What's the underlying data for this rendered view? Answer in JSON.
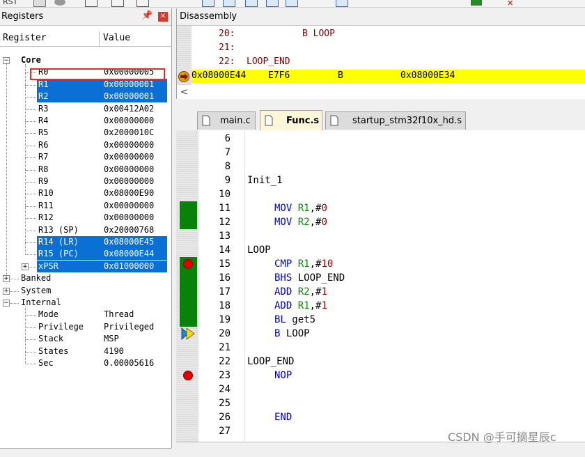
{
  "toolbar": {
    "rst_label": "RST"
  },
  "registers_panel": {
    "title": "Registers",
    "pin_icon": "pin-icon",
    "close_icon": "close-icon",
    "columns": {
      "register": "Register",
      "value": "Value"
    },
    "core_label": "Core",
    "core_registers": [
      {
        "name": "R0",
        "value": "0x00000005",
        "selected": false,
        "highlighted": true
      },
      {
        "name": "R1",
        "value": "0x00000001",
        "selected": true
      },
      {
        "name": "R2",
        "value": "0x00000001",
        "selected": true
      },
      {
        "name": "R3",
        "value": "0x00412A02",
        "selected": false
      },
      {
        "name": "R4",
        "value": "0x00000000",
        "selected": false
      },
      {
        "name": "R5",
        "value": "0x2000010C",
        "selected": false
      },
      {
        "name": "R6",
        "value": "0x00000000",
        "selected": false
      },
      {
        "name": "R7",
        "value": "0x00000000",
        "selected": false
      },
      {
        "name": "R8",
        "value": "0x00000000",
        "selected": false
      },
      {
        "name": "R9",
        "value": "0x00000000",
        "selected": false
      },
      {
        "name": "R10",
        "value": "0x08000E90",
        "selected": false
      },
      {
        "name": "R11",
        "value": "0x00000000",
        "selected": false
      },
      {
        "name": "R12",
        "value": "0x00000000",
        "selected": false
      },
      {
        "name": "R13 (SP)",
        "value": "0x20000768",
        "selected": false
      },
      {
        "name": "R14 (LR)",
        "value": "0x08000E45",
        "selected": true
      },
      {
        "name": "R15 (PC)",
        "value": "0x08000E44",
        "selected": true
      },
      {
        "name": "xPSR",
        "value": "0x01000000",
        "selected": true
      }
    ],
    "groups": [
      "Banked",
      "System",
      "Internal"
    ],
    "internal": [
      {
        "name": "Mode",
        "value": "Thread"
      },
      {
        "name": "Privilege",
        "value": "Privileged"
      },
      {
        "name": "Stack",
        "value": "MSP"
      },
      {
        "name": "States",
        "value": "4190"
      },
      {
        "name": "Sec",
        "value": "0.00005616"
      }
    ]
  },
  "disassembly": {
    "title": "Disassembly",
    "lines": [
      {
        "num": "20:",
        "text": "B LOOP"
      },
      {
        "num": "21:",
        "text": ""
      },
      {
        "num": "22:",
        "text": "LOOP_END"
      }
    ],
    "current": {
      "address": "0x08000E44",
      "opcode": "E7F6",
      "mnemonic": "B",
      "target": "0x08000E34"
    }
  },
  "tabs": [
    {
      "label": "main.c",
      "active": false
    },
    {
      "label": "Func.s",
      "active": true
    },
    {
      "label": "startup_stm32f10x_hd.s",
      "active": false
    }
  ],
  "editor": {
    "lines": [
      {
        "num": "6",
        "code": ""
      },
      {
        "num": "7",
        "code": ""
      },
      {
        "num": "8",
        "code": ""
      },
      {
        "num": "9",
        "code": "Init_1"
      },
      {
        "num": "10",
        "code": ""
      },
      {
        "num": "11",
        "instr": "MOV",
        "args": [
          [
            "R1",
            "rg"
          ],
          [
            ",#",
            ""
          ],
          [
            "0",
            "nm2"
          ]
        ]
      },
      {
        "num": "12",
        "instr": "MOV",
        "args": [
          [
            "R2",
            "rg"
          ],
          [
            ",#",
            ""
          ],
          [
            "0",
            "nm2"
          ]
        ]
      },
      {
        "num": "13",
        "code": ""
      },
      {
        "num": "14",
        "code": "LOOP"
      },
      {
        "num": "15",
        "instr": "CMP",
        "args": [
          [
            "R1",
            "rg"
          ],
          [
            ",#",
            ""
          ],
          [
            "10",
            "nm2"
          ]
        ]
      },
      {
        "num": "16",
        "instr": "BHS",
        "args": [
          [
            "LOOP_END",
            ""
          ]
        ]
      },
      {
        "num": "17",
        "instr": "ADD",
        "args": [
          [
            "R2",
            "rg"
          ],
          [
            ",#",
            ""
          ],
          [
            "1",
            "nm2"
          ]
        ]
      },
      {
        "num": "18",
        "instr": "ADD",
        "args": [
          [
            "R1",
            "rg"
          ],
          [
            ",#",
            ""
          ],
          [
            "1",
            "nm2"
          ]
        ]
      },
      {
        "num": "19",
        "instr": "BL",
        "args": [
          [
            "get5",
            ""
          ]
        ]
      },
      {
        "num": "20",
        "instr": "B",
        "args": [
          [
            "LOOP",
            ""
          ]
        ]
      },
      {
        "num": "21",
        "code": ""
      },
      {
        "num": "22",
        "code": "LOOP_END"
      },
      {
        "num": "23",
        "instr": "NOP",
        "args": []
      },
      {
        "num": "24",
        "code": ""
      },
      {
        "num": "25",
        "code": ""
      },
      {
        "num": "26",
        "instr": "END",
        "args": []
      },
      {
        "num": "27",
        "code": ""
      }
    ]
  },
  "watermark": "CSDN @手可摘星辰c",
  "colors": {
    "selection": "#0a70d6",
    "current_line": "#ffff00",
    "breakpoint": "#e00000",
    "coverage": "#088208",
    "highlight_box": "#d9322c"
  }
}
